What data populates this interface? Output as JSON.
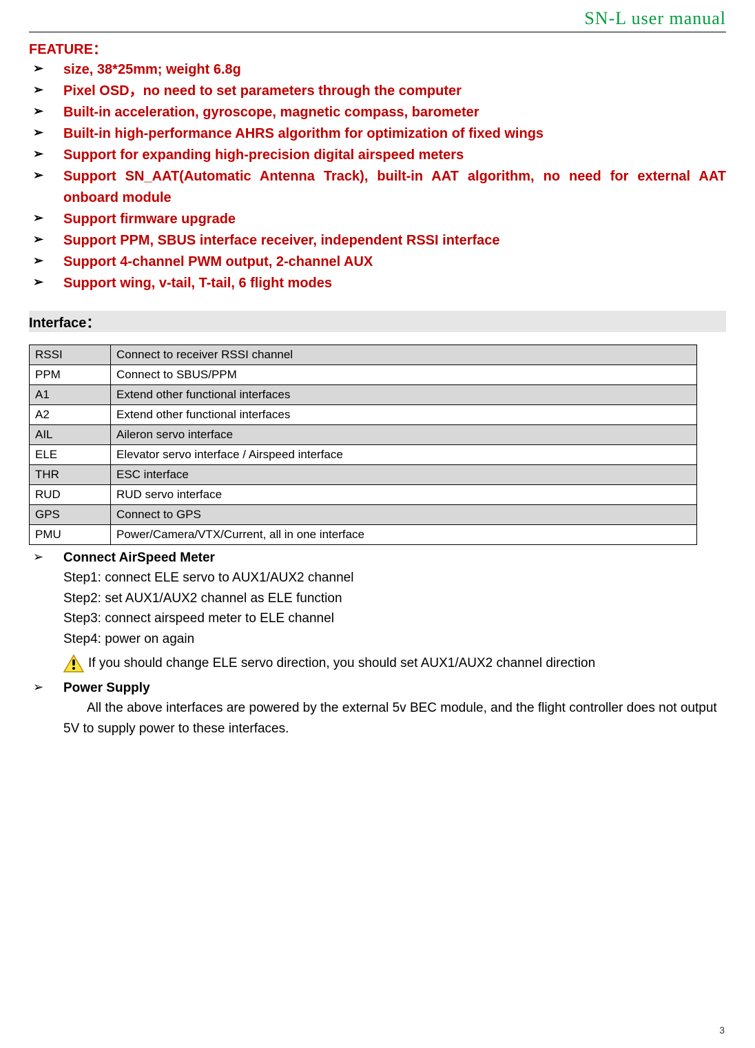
{
  "header": {
    "title": "SN-L user manual"
  },
  "feature": {
    "heading": "FEATURE：",
    "items": [
      "size, 38*25mm; weight 6.8g",
      "Pixel OSD，no need to set parameters through the computer",
      "Built-in acceleration, gyroscope, magnetic compass, barometer",
      "Built-in high-performance AHRS algorithm for optimization of fixed wings",
      "Support for expanding high-precision digital airspeed meters",
      "Support SN_AAT(Automatic Antenna Track), built-in AAT algorithm, no need for external AAT onboard module",
      "Support firmware upgrade",
      "Support PPM, SBUS interface receiver, independent RSSI interface",
      "Support 4-channel PWM output, 2-channel AUX",
      "Support wing, v-tail, T-tail, 6 flight modes"
    ]
  },
  "interface": {
    "heading": "Interface：",
    "rows": [
      {
        "label": "RSSI",
        "desc": "Connect to receiver RSSI channel"
      },
      {
        "label": "PPM",
        "desc": "Connect to SBUS/PPM"
      },
      {
        "label": "A1",
        "desc": "Extend other functional interfaces"
      },
      {
        "label": "A2",
        "desc": "Extend other functional interfaces"
      },
      {
        "label": "AIL",
        "desc": "Aileron servo interface"
      },
      {
        "label": "ELE",
        "desc": "Elevator servo interface / Airspeed interface"
      },
      {
        "label": "THR",
        "desc": "ESC interface"
      },
      {
        "label": "RUD",
        "desc": "RUD servo interface"
      },
      {
        "label": "GPS",
        "desc": "Connect to GPS"
      },
      {
        "label": "PMU",
        "desc": "Power/Camera/VTX/Current, all in one interface"
      }
    ]
  },
  "airspeed": {
    "title": "Connect AirSpeed Meter",
    "steps": [
      "Step1: connect ELE servo to AUX1/AUX2 channel",
      "Step2: set AUX1/AUX2 channel as ELE function",
      "Step3: connect airspeed meter to ELE channel",
      "Step4: power on again"
    ],
    "warning": "If you should change ELE servo direction, you should set AUX1/AUX2 channel direction"
  },
  "power": {
    "title": "Power Supply",
    "text_line1": "All the above interfaces are powered by the external 5v BEC module, and the flight controller does not output",
    "text_line2": "5V to supply power to these interfaces."
  },
  "page_number": "3"
}
